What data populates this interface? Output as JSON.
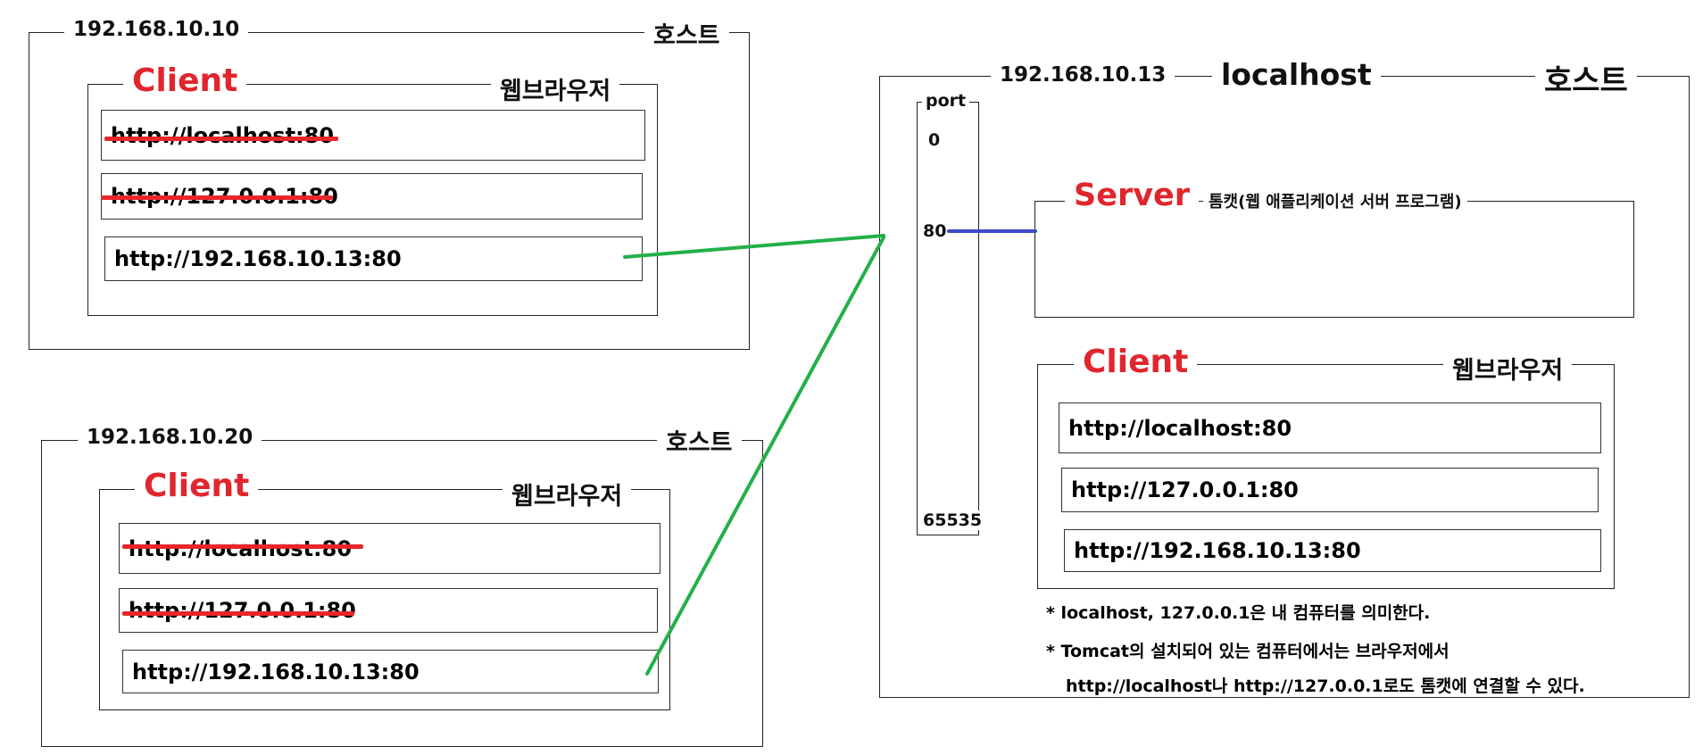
{
  "host1": {
    "ip": "192.168.10.10",
    "label": "호스트",
    "client": {
      "title": "Client",
      "app": "웹브라우저",
      "urls": [
        "http://localhost:80",
        "http://127.0.0.1:80",
        "http://192.168.10.13:80"
      ],
      "struck": [
        true,
        true,
        false
      ]
    }
  },
  "host2": {
    "ip": "192.168.10.20",
    "label": "호스트",
    "client": {
      "title": "Client",
      "app": "웹브라우저",
      "urls": [
        "http://localhost:80",
        "http://127.0.0.1:80",
        "http://192.168.10.13:80"
      ],
      "struck": [
        true,
        true,
        false
      ]
    }
  },
  "server_host": {
    "ip": "192.168.10.13",
    "name": "localhost",
    "label": "호스트",
    "ports": {
      "title": "port",
      "values": [
        "0",
        "80",
        "65535"
      ]
    },
    "server": {
      "title": "Server",
      "app": "톰캣(웹 애플리케이션 서버 프로그램)"
    },
    "client": {
      "title": "Client",
      "app": "웹브라우저",
      "urls": [
        "http://localhost:80",
        "http://127.0.0.1:80",
        "http://192.168.10.13:80"
      ]
    },
    "notes": [
      "* localhost, 127.0.0.1은 내 컴퓨터를 의미한다.",
      "* Tomcat의 설치되어 있는 컴퓨터에서는 브라우저에서",
      "http://localhost나 http://127.0.0.1로도 톰캣에 연결할 수 있다."
    ]
  },
  "colors": {
    "connection": "#22b04b",
    "port_link": "#3f48cc",
    "strike": "#e8262b",
    "client_title": "#e0262d"
  }
}
